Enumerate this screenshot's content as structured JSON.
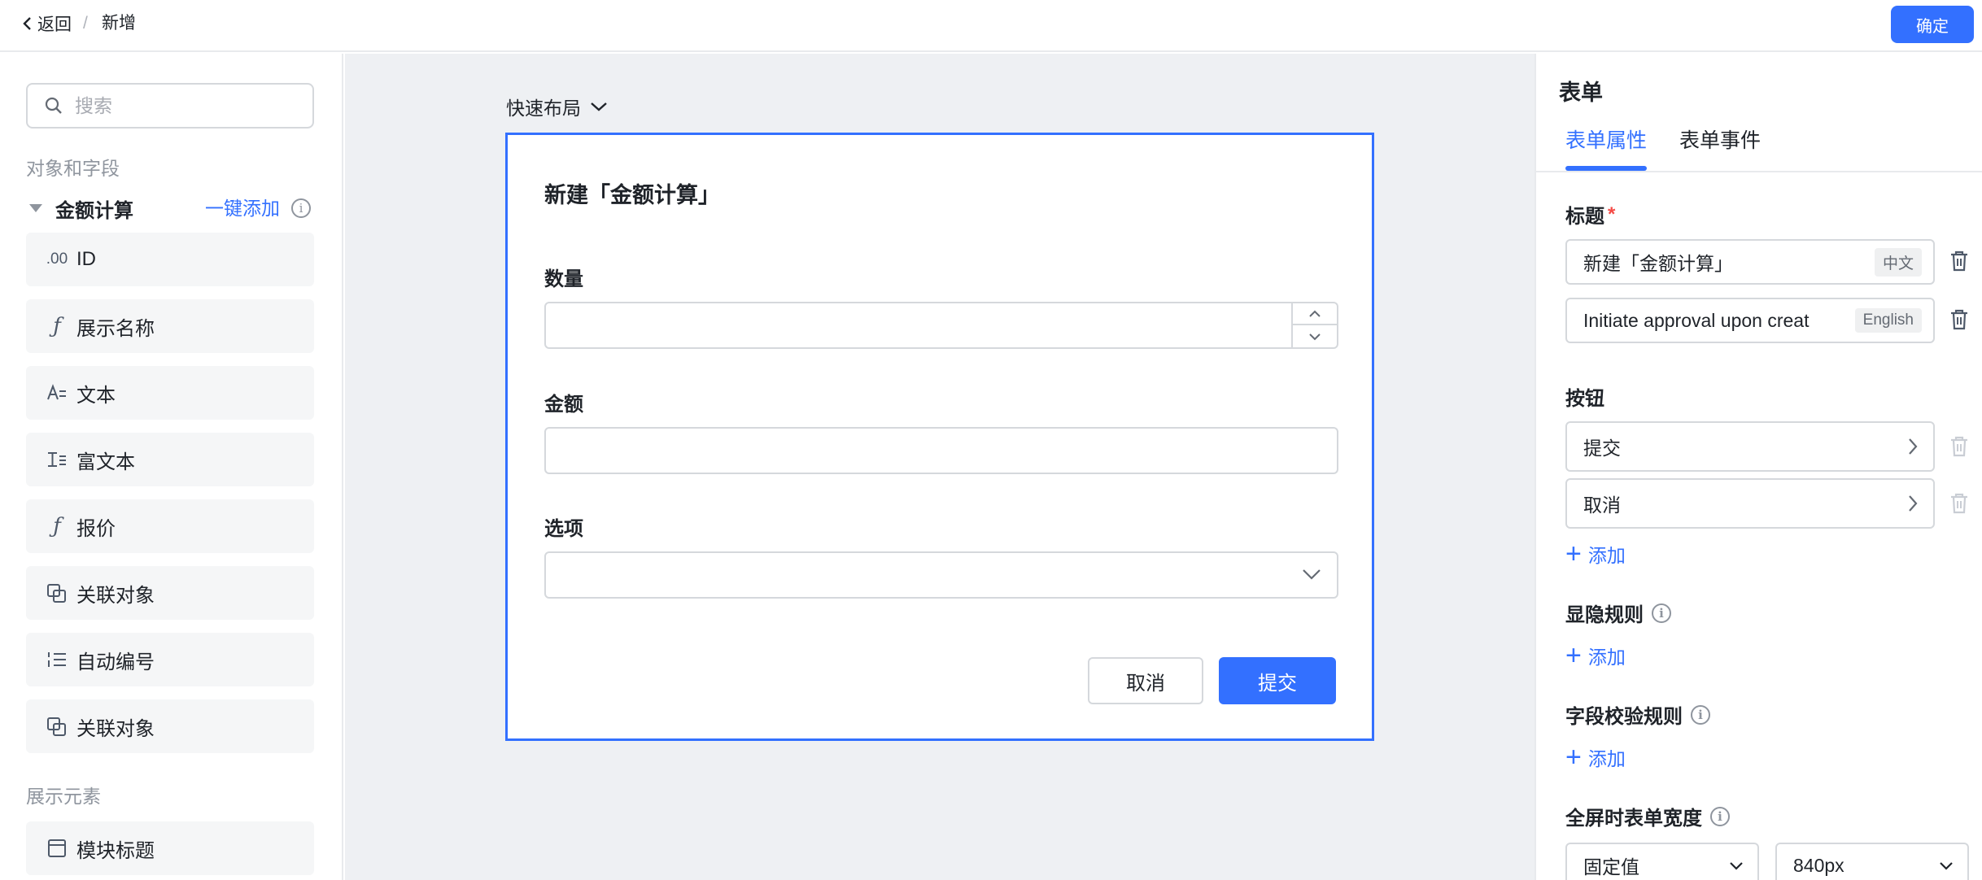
{
  "topbar": {
    "back_label": "返回",
    "separator": "/",
    "current": "新增",
    "confirm_label": "确定"
  },
  "left_panel": {
    "search_placeholder": "搜索",
    "section_objects": "对象和字段",
    "group_name": "金额计算",
    "add_all_label": "一键添加",
    "fields": [
      {
        "icon": "number-icon",
        "icon_text": ".00",
        "label": "ID"
      },
      {
        "icon": "formula-icon",
        "icon_text": "ƒ",
        "label": "展示名称"
      },
      {
        "icon": "text-icon",
        "icon_text": "",
        "label": "文本"
      },
      {
        "icon": "rich-text-icon",
        "icon_text": "",
        "label": "富文本"
      },
      {
        "icon": "formula-icon",
        "icon_text": "ƒ",
        "label": "报价"
      },
      {
        "icon": "lookup-icon",
        "icon_text": "",
        "label": "关联对象"
      },
      {
        "icon": "auto-number-icon",
        "icon_text": "",
        "label": "自动编号"
      },
      {
        "icon": "lookup-icon",
        "icon_text": "",
        "label": "关联对象"
      }
    ],
    "section_display": "展示元素",
    "display_items": [
      {
        "icon": "block-title-icon",
        "label": "模块标题"
      }
    ]
  },
  "canvas": {
    "quick_layout_label": "快速布局",
    "form": {
      "title": "新建「金额计算」",
      "fields": [
        {
          "label": "数量",
          "type": "number",
          "value": ""
        },
        {
          "label": "金额",
          "type": "text",
          "value": ""
        },
        {
          "label": "选项",
          "type": "select",
          "value": ""
        }
      ],
      "cancel_label": "取消",
      "submit_label": "提交"
    }
  },
  "right_panel": {
    "title": "表单",
    "tabs": [
      {
        "label": "表单属性",
        "active": true
      },
      {
        "label": "表单事件",
        "active": false
      }
    ],
    "title_label": "标题",
    "required_mark": "*",
    "title_values": [
      {
        "value": "新建「金额计算」",
        "lang": "中文"
      },
      {
        "value": "Initiate approval upon creat",
        "lang": "English"
      }
    ],
    "buttons_label": "按钮",
    "buttons": [
      {
        "label": "提交"
      },
      {
        "label": "取消"
      }
    ],
    "add_label": "添加",
    "visibility_rules_label": "显隐规则",
    "validation_rules_label": "字段校验规则",
    "fullscreen_width_label": "全屏时表单宽度",
    "width_mode": "固定值",
    "width_value": "840px"
  },
  "colors": {
    "accent": "#3370ff",
    "canvas_bg": "#eef0f3",
    "border": "#d5d8dc",
    "required": "#f54a45"
  }
}
